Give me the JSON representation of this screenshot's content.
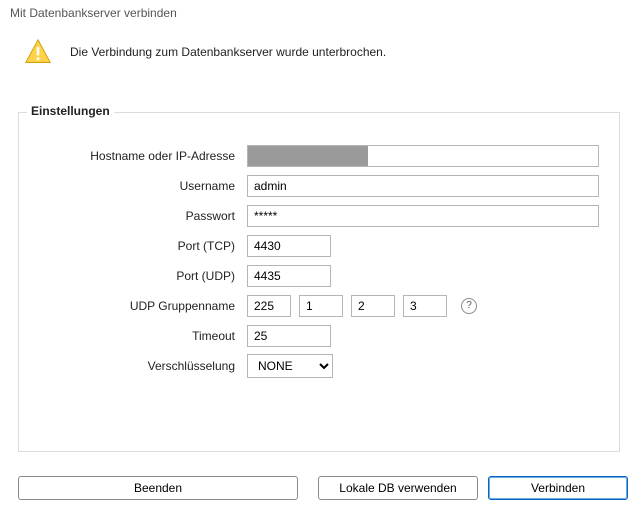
{
  "title": "Mit Datenbankserver verbinden",
  "message": "Die Verbindung zum Datenbankserver wurde unterbrochen.",
  "group": {
    "legend": "Einstellungen"
  },
  "labels": {
    "hostname": "Hostname oder IP-Adresse",
    "username": "Username",
    "password": "Passwort",
    "port_tcp": "Port (TCP)",
    "port_udp": "Port (UDP)",
    "udp_group": "UDP Gruppenname",
    "timeout": "Timeout",
    "encryption": "Verschlüsselung"
  },
  "values": {
    "hostname": "",
    "username": "admin",
    "password": "*****",
    "port_tcp": "4430",
    "port_udp": "4435",
    "udp_group": [
      "225",
      "1",
      "2",
      "3"
    ],
    "timeout": "25",
    "encryption": "NONE"
  },
  "buttons": {
    "quit": "Beenden",
    "local": "Lokale DB verwenden",
    "connect": "Verbinden"
  },
  "help_glyph": "?"
}
